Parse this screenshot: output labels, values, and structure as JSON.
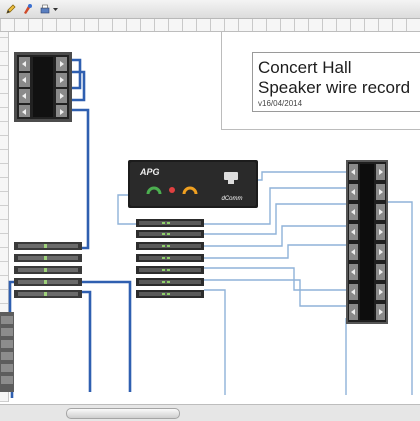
{
  "toolbar": {
    "icons": [
      "edit-icon",
      "color-picker-icon",
      "print-icon"
    ]
  },
  "title_block": {
    "title": "Concert Hall",
    "subtitle": "Speaker wire record",
    "version": "v16/04/2014"
  },
  "devices": {
    "amp_rack_top_left": {
      "icon": "amplifier-rack-icon"
    },
    "stage_rack_right": {
      "icon": "speaker-panel-icon"
    },
    "rack_left_lower": {
      "icon": "patch-panel-icon"
    },
    "cabinet_bottom_left": {
      "icon": "equipment-cabinet-icon"
    },
    "processor_unit": {
      "brand": "APG",
      "model": "dComm",
      "icon": "processor-icon"
    },
    "amp_stack_center": {
      "icon": "amplifier-stack-icon"
    }
  },
  "colors": {
    "blue_wire": "#2f5fb0",
    "light_wire": "#8fb2d8",
    "rack_dark": "#262626",
    "rack_grey": "#6a6a6a"
  }
}
